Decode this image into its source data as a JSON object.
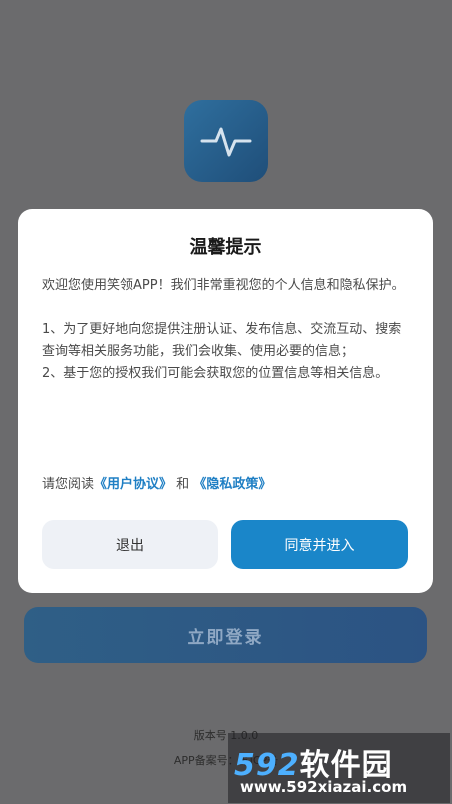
{
  "background": {
    "login_button_label": "立即登录",
    "version_text": "版本号 1.0.0",
    "icp_text": "APP备案号：苏ICP备"
  },
  "app_icon": {
    "icon": "pulse-wave-icon",
    "color": "#2a5f8f"
  },
  "dialog": {
    "title": "温馨提示",
    "paragraph1": "欢迎您使用笑领APP！我们非常重视您的个人信息和隐私保护。",
    "item1": "1、为了更好地向您提供注册认证、发布信息、交流互动、搜索查询等相关服务功能，我们会收集、使用必要的信息；",
    "item2": "2、基于您的授权我们可能会获取您的位置信息等相关信息。",
    "read_prefix": "请您阅读",
    "user_agreement_link": "《用户协议》",
    "and_text": "和",
    "privacy_policy_link": "《隐私政策》",
    "exit_button": "退出",
    "agree_button": "同意并进入",
    "accent_color": "#1a86c9"
  },
  "watermark": {
    "logo_digits": "592",
    "logo_text": "软件园",
    "url": "www.592xiazai.com"
  }
}
